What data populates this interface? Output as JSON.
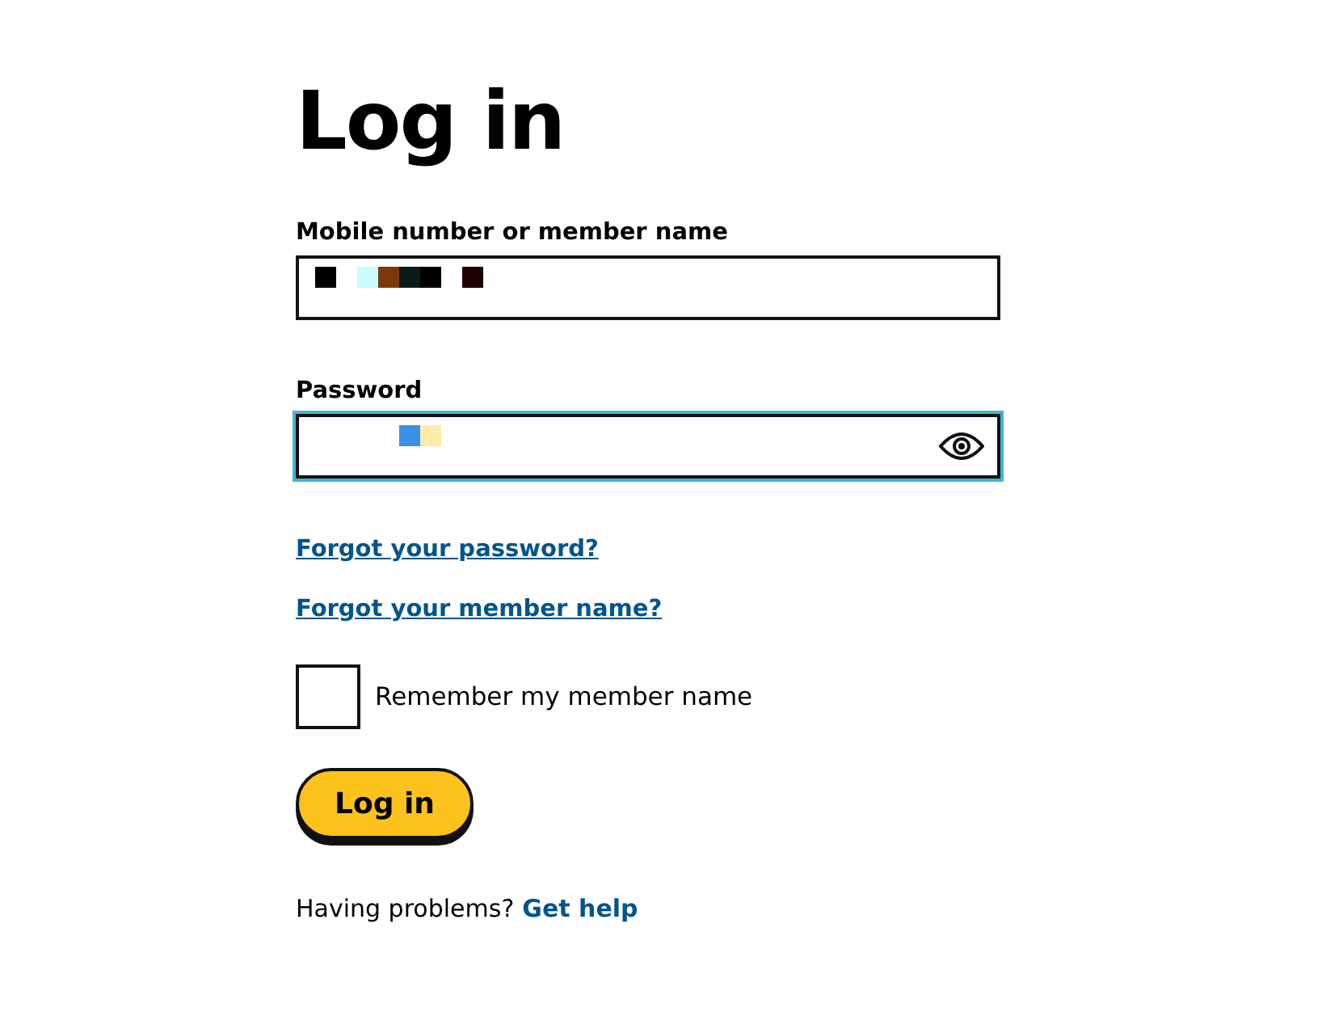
{
  "title": "Log in",
  "fields": [
    {
      "label": "Mobile number or member name",
      "kind": "text",
      "focused": false
    },
    {
      "label": "Password",
      "kind": "password",
      "focused": true
    }
  ],
  "links": [
    "Forgot your password?",
    "Forgot your member name?"
  ],
  "remember": {
    "label": "Remember my member name",
    "checked": false
  },
  "login_button": "Log in",
  "help": {
    "text": "Having problems?",
    "link": "Get help"
  }
}
